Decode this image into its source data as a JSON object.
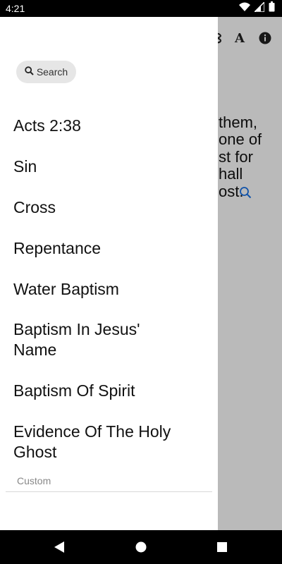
{
  "status_bar": {
    "time": "4:21",
    "icons": [
      "wifi-icon",
      "signal-icon",
      "battery-icon"
    ]
  },
  "app_toolbar": {
    "font_label": "A",
    "icons": [
      "partial-icon",
      "font-size-icon",
      "info-icon"
    ]
  },
  "verse": {
    "lines": [
      "them,",
      "one of",
      "st for",
      "hall",
      "ost."
    ],
    "magnifier_color": "#1a73e8"
  },
  "drawer": {
    "search_label": "Search",
    "items": [
      {
        "label": "Acts 2:38"
      },
      {
        "label": "Sin"
      },
      {
        "label": "Cross"
      },
      {
        "label": "Repentance"
      },
      {
        "label": "Water Baptism"
      },
      {
        "label": "Baptism In Jesus' Name"
      },
      {
        "label": "Baptism Of Spirit"
      },
      {
        "label": "Evidence Of The Holy Ghost"
      }
    ],
    "section_label": "Custom"
  },
  "nav_bar": {
    "buttons": [
      "back-icon",
      "home-icon",
      "recents-icon"
    ]
  }
}
